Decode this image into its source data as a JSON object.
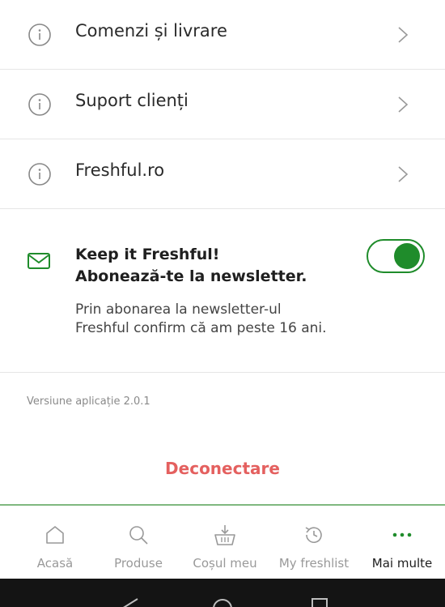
{
  "menu": {
    "items": [
      {
        "label": "Comenzi și livrare"
      },
      {
        "label": "Suport clienți"
      },
      {
        "label": "Freshful.ro"
      }
    ]
  },
  "newsletter": {
    "title_line1": "Keep it Freshful!",
    "title_line2": "Abonează-te la newsletter.",
    "description_line1": "Prin abonarea la newsletter-ul",
    "description_line2": "Freshful confirm că am peste 16 ani.",
    "subscribed": true
  },
  "app": {
    "version_text": "Versiune aplicație 2.0.1"
  },
  "logout_label": "Deconectare",
  "tabbar": {
    "tabs": [
      {
        "label": "Acasă",
        "icon": "home-icon"
      },
      {
        "label": "Produse",
        "icon": "search-icon"
      },
      {
        "label": "Coșul meu",
        "icon": "basket-icon"
      },
      {
        "label": "My freshlist",
        "icon": "history-icon"
      },
      {
        "label": "Mai multe",
        "icon": "more-icon",
        "active": true
      }
    ]
  },
  "colors": {
    "accent": "#1f8c2b",
    "logout": "#e4605f",
    "tab_border": "#7fb87f"
  }
}
